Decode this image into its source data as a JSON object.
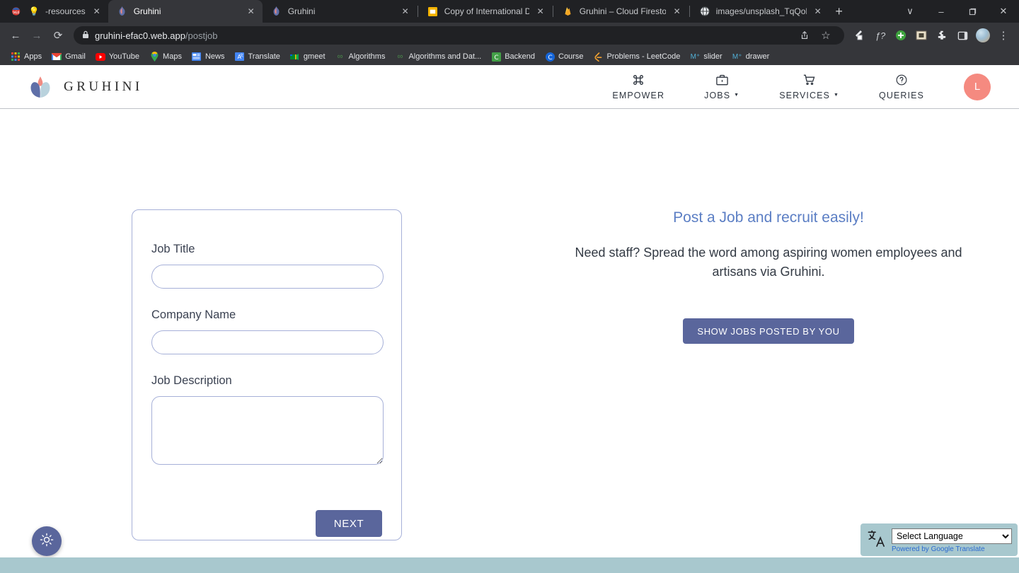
{
  "browser": {
    "tabs": [
      {
        "title": "-resources",
        "favicon": "badge-968-bulb-icon",
        "active": false
      },
      {
        "title": "Gruhini",
        "favicon": "gruhini-flame-icon",
        "active": true
      },
      {
        "title": "Gruhini",
        "favicon": "gruhini-flame-icon",
        "active": false
      },
      {
        "title": "Copy of International Day f",
        "favicon": "google-slides-icon",
        "active": false
      },
      {
        "title": "Gruhini – Cloud Firestore –",
        "favicon": "firebase-icon",
        "active": false
      },
      {
        "title": "images/unsplash_TqQoPFLi",
        "favicon": "globe-icon",
        "active": false
      }
    ],
    "new_tab_label": "+",
    "window_controls": {
      "search": "∨",
      "minimize": "‒",
      "maximize": "❐",
      "close": "✕"
    },
    "toolbar": {
      "back": "←",
      "forward": "→",
      "reload": "⟳",
      "lock": "🔒",
      "url_host": "gruhini-efac0.web.app",
      "url_path": "/postjob",
      "share": "share-icon",
      "bookmark_star": "☆",
      "menu": "⋮"
    },
    "extensions": [
      {
        "name": "pen-extension-icon",
        "glyph": "✒"
      },
      {
        "name": "f-question-extension-icon",
        "glyph": "ƒ?"
      },
      {
        "name": "green-plus-extension-icon",
        "glyph": "+"
      },
      {
        "name": "archive-extension-icon",
        "glyph": "▣"
      },
      {
        "name": "puzzle-extensions-icon",
        "glyph": "❖"
      },
      {
        "name": "sidepanel-icon",
        "glyph": "□"
      }
    ],
    "bookmarks": [
      {
        "label": "Apps",
        "icon": "apps-grid-icon"
      },
      {
        "label": "Gmail",
        "icon": "gmail-icon"
      },
      {
        "label": "YouTube",
        "icon": "youtube-icon"
      },
      {
        "label": "Maps",
        "icon": "maps-pin-icon"
      },
      {
        "label": "News",
        "icon": "google-news-icon"
      },
      {
        "label": "Translate",
        "icon": "translate-icon"
      },
      {
        "label": "gmeet",
        "icon": "google-meet-icon"
      },
      {
        "label": "Algorithms",
        "icon": "glasses-icon"
      },
      {
        "label": "Algorithms and Dat...",
        "icon": "glasses-icon"
      },
      {
        "label": "Backend",
        "icon": "green-c-icon"
      },
      {
        "label": "Course",
        "icon": "blue-c-icon"
      },
      {
        "label": "Problems - LeetCode",
        "icon": "leetcode-icon"
      },
      {
        "label": "slider",
        "icon": "material-icon"
      },
      {
        "label": "drawer",
        "icon": "material-icon"
      }
    ]
  },
  "site": {
    "brand": "GRUHINI",
    "logo_icon": "lotus-flower-logo-icon",
    "nav": [
      {
        "label": "EMPOWER",
        "icon": "command-loop-icon",
        "has_caret": false
      },
      {
        "label": "JOBS",
        "icon": "briefcase-icon",
        "has_caret": true
      },
      {
        "label": "SERVICES",
        "icon": "shopping-cart-icon",
        "has_caret": true
      },
      {
        "label": "QUERIES",
        "icon": "question-circle-icon",
        "has_caret": false
      }
    ],
    "avatar_initial": "L",
    "avatar_color": "#f58a80"
  },
  "form": {
    "fields": [
      {
        "label": "Job Title",
        "value": "",
        "placeholder": "",
        "type": "text"
      },
      {
        "label": "Company Name",
        "value": "",
        "placeholder": "",
        "type": "text"
      },
      {
        "label": "Job Description",
        "value": "",
        "placeholder": "",
        "type": "textarea"
      }
    ],
    "next_label": "NEXT",
    "accent_color": "#5a669c",
    "border_color": "#a6b0d8"
  },
  "promo": {
    "title": "Post a Job and recruit easily!",
    "subtitle": "Need staff? Spread the word among aspiring women employees and artisans via Gruhini.",
    "button_label": "SHOW JOBS POSTED BY YOU",
    "title_color": "#5b7ec4"
  },
  "theme_toggle": {
    "icon": "sun-brightness-icon"
  },
  "translate": {
    "icon": "google-translate-icon",
    "selected": "Select Language",
    "options": [
      "Select Language"
    ],
    "powered_by": "Powered by Google Translate",
    "background_color": "#a8c8ce"
  },
  "footer": {
    "color": "#a8c8ce"
  }
}
